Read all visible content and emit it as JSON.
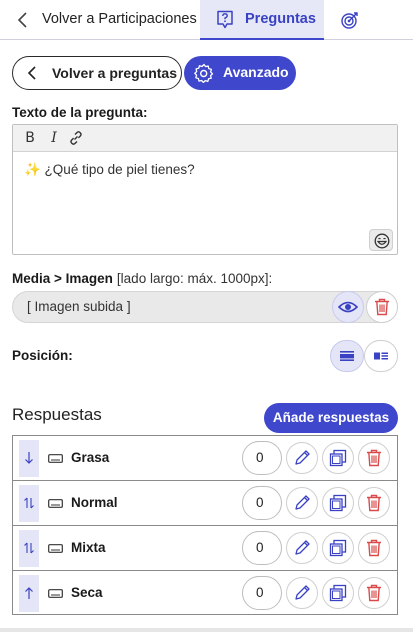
{
  "tabs": {
    "back_label": "Volver a Participaciones",
    "questions_label": "Preguntas",
    "target_icon": "target-icon"
  },
  "actions": {
    "back_to_questions": "Volver a preguntas",
    "advanced": "Avanzado"
  },
  "question": {
    "label": "Texto de la pregunta:",
    "toolbar": {
      "bold": "B",
      "italic": "I"
    },
    "text": "✨ ¿Qué tipo de piel tienes?"
  },
  "media": {
    "label": "Media > Imagen",
    "hint": "[lado largo: máx. 1000px]:",
    "value": "[ Imagen subida ]"
  },
  "position": {
    "label": "Posición:",
    "selected": "full-width"
  },
  "answers": {
    "title": "Respuestas",
    "add_label": "Añade respuestas",
    "items": [
      {
        "label": "Grasa",
        "score": "0",
        "arrow": "down"
      },
      {
        "label": "Normal",
        "score": "0",
        "arrow": "updown"
      },
      {
        "label": "Mixta",
        "score": "0",
        "arrow": "updown"
      },
      {
        "label": "Seca",
        "score": "0",
        "arrow": "up"
      }
    ]
  },
  "colors": {
    "accent": "#3f47cc",
    "accent_light": "#e4e5f6",
    "danger": "#d94a4a"
  }
}
